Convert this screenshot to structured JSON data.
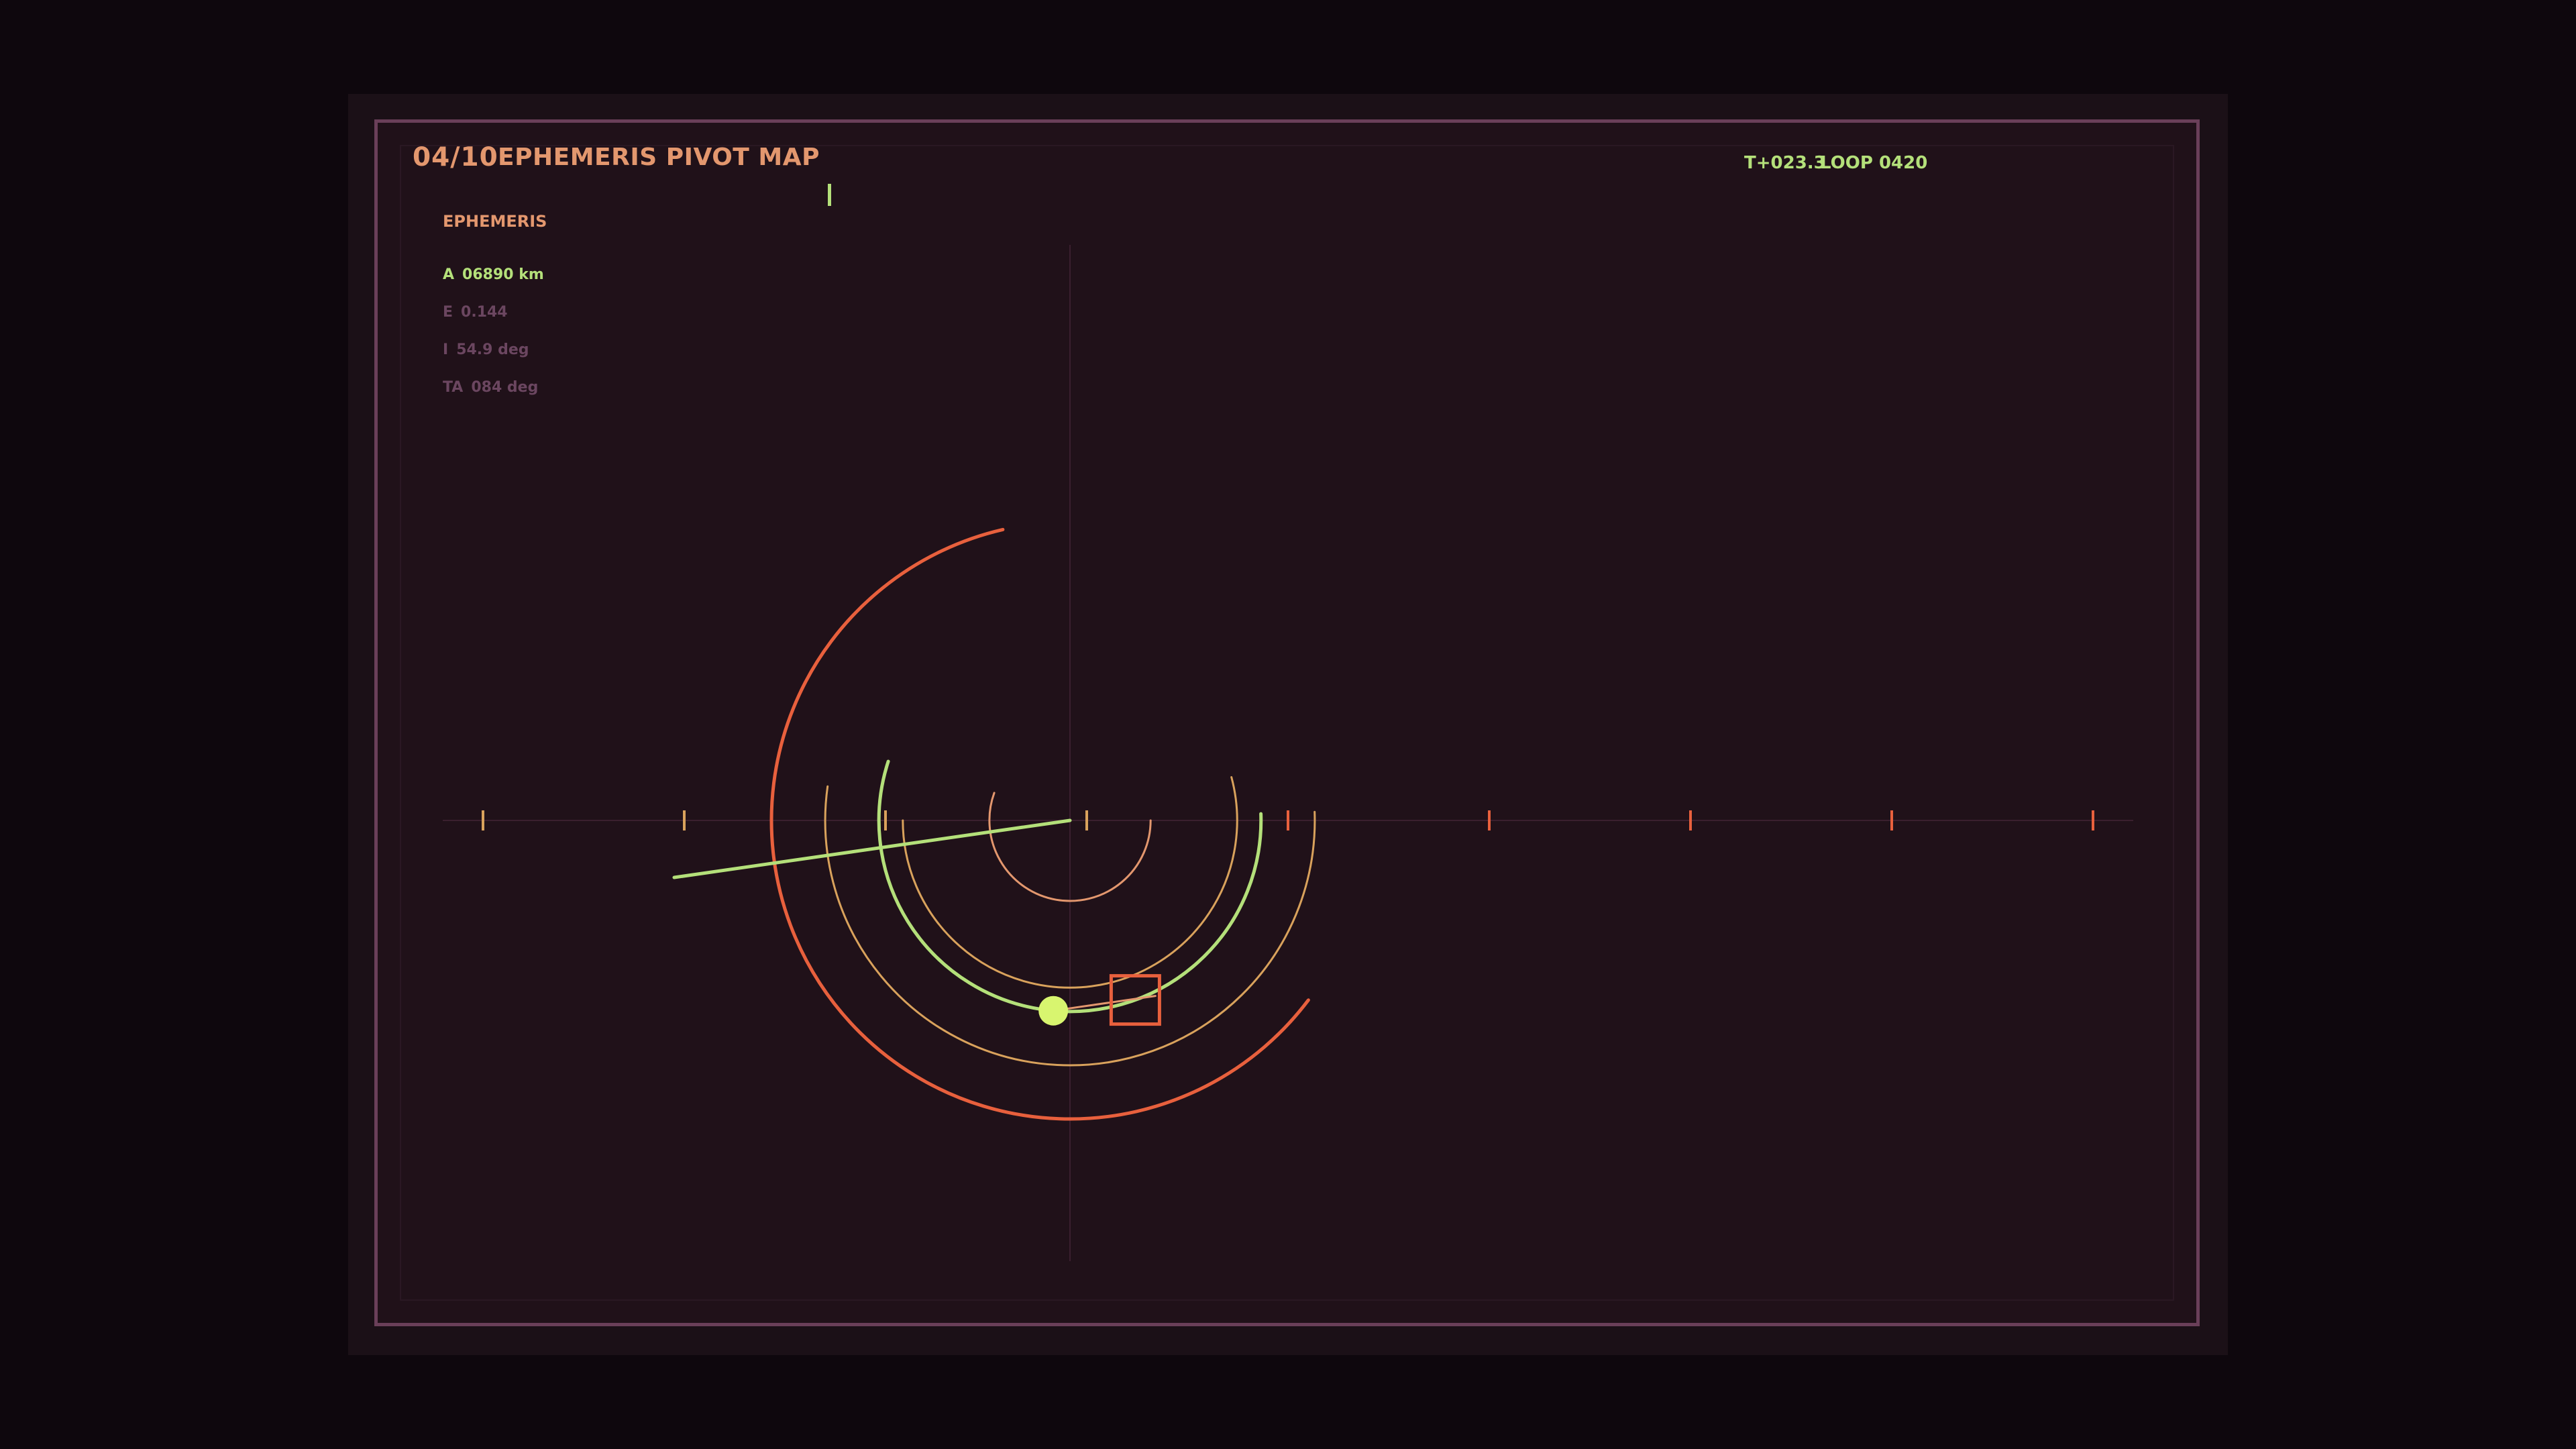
{
  "header": {
    "index": "04/10",
    "title": "EPHEMERIS PIVOT MAP",
    "status_time": "T+023.3",
    "status_loop": "LOOP 0420"
  },
  "ephemeris": {
    "section_title": "EPHEMERIS",
    "readouts": [
      {
        "key": "A",
        "value": "06890 km",
        "state": "active"
      },
      {
        "key": "E",
        "value": "0.144",
        "state": "dim"
      },
      {
        "key": "I",
        "value": "54.9 deg",
        "state": "dim"
      },
      {
        "key": "TA",
        "value": "084 deg",
        "state": "dim"
      }
    ]
  },
  "colors": {
    "background": "#0e070d",
    "panel": "#201119",
    "frame_border": "#6a3f59",
    "accent_orange": "#e3976e",
    "accent_green": "#b4e07a",
    "accent_red": "#e8603d",
    "accent_amber": "#d9a25c",
    "satellite": "#d8f56f",
    "dim_text": "#6b4660"
  },
  "map": {
    "rings": [
      {
        "name": "inner-ring",
        "radius_ratio": 0.27,
        "start_deg": 0,
        "sweep_deg": 200,
        "color": "#e3976e",
        "weight": "thin"
      },
      {
        "name": "ring-2",
        "radius_ratio": 0.56,
        "start_deg": -15,
        "sweep_deg": 195,
        "color": "#d9a25c",
        "weight": "thin"
      },
      {
        "name": "ring-3-active",
        "radius_ratio": 0.64,
        "start_deg": -2,
        "sweep_deg": 200,
        "color": "#b4e07a",
        "weight": "bold"
      },
      {
        "name": "ring-4",
        "radius_ratio": 0.82,
        "start_deg": -2,
        "sweep_deg": 190,
        "color": "#d9a25c",
        "weight": "thin"
      },
      {
        "name": "outer-ring",
        "radius_ratio": 1.0,
        "start_deg": 37,
        "sweep_deg": 220,
        "color": "#e8603d",
        "weight": "bold"
      }
    ],
    "satellite_angle_deg": 95,
    "target_angle_deg": 70,
    "axis_ticks": 9
  }
}
